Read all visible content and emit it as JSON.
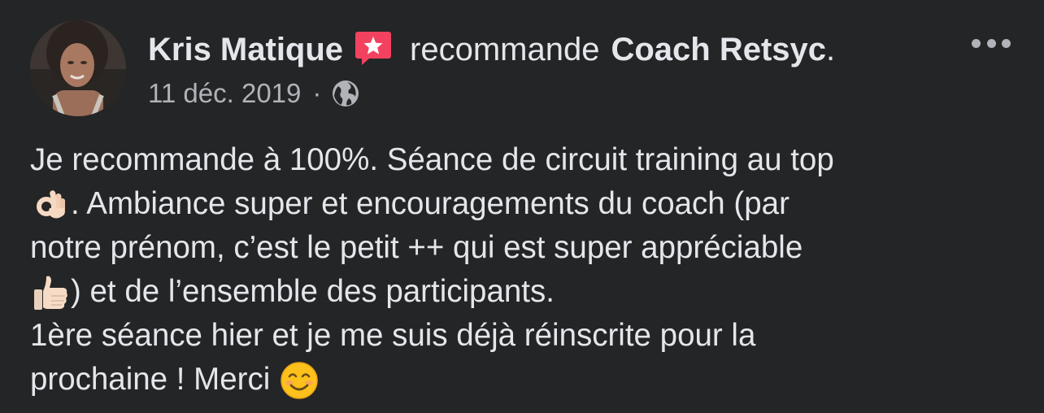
{
  "post": {
    "author_name": "Kris Matique",
    "action_text": "recommande",
    "page_name": "Coach Retsyc",
    "end_punct": ".",
    "date": "11 déc. 2019",
    "separator": "·",
    "privacy_icon": "globe-icon",
    "recommend_icon": "recommendation-star-icon",
    "more_icon": "more-options-icon"
  },
  "review": {
    "line1": "Je recommande à 100%. Séance de circuit training au top",
    "line2_emoji": "ok-hand-emoji",
    "line2": ". Ambiance super et encouragements du coach (par",
    "line3": "notre prénom, c’est le petit ++ qui est super appréciable",
    "line4_emoji": "thumbs-up-emoji",
    "line4": ") et de l’ensemble des participants.",
    "line5": "1ère séance hier et je me suis déjà réinscrite pour la",
    "line6": "prochaine ! Merci ",
    "line6_emoji": "smiling-face-emoji"
  },
  "colors": {
    "background": "#242526",
    "text_primary": "#e4e6eb",
    "text_secondary": "#b0b3b8",
    "recommend_red": "#f3425f"
  }
}
